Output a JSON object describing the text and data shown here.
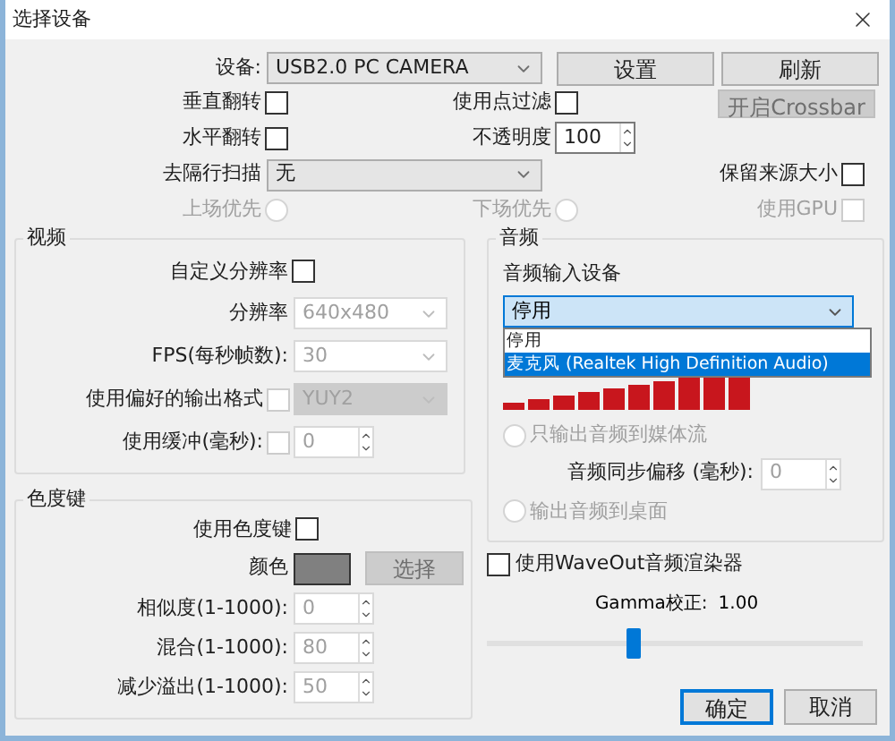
{
  "window": {
    "title": "选择设备"
  },
  "device": {
    "label": "设备:",
    "value": "USB2.0 PC CAMERA"
  },
  "buttons": [
    {
      "label": "设置",
      "disabled": false
    },
    {
      "label": "刷新",
      "disabled": false
    },
    {
      "label": "开启Crossbar",
      "disabled": true
    }
  ],
  "flip_vertical": {
    "label": "垂直翻转",
    "checked": false
  },
  "point_filter": {
    "label": "使用点过滤",
    "checked": false
  },
  "flip_horizontal": {
    "label": "水平翻转",
    "checked": false
  },
  "opacity": {
    "label": "不透明度",
    "value": "100"
  },
  "deinterlace": {
    "label": "去隔行扫描",
    "value": "无"
  },
  "keep_source_size": {
    "label": "保留来源大小",
    "checked": false
  },
  "field_top": {
    "label": "上场优先",
    "selected": false,
    "disabled": true
  },
  "field_bottom": {
    "label": "下场优先",
    "selected": false,
    "disabled": true
  },
  "use_gpu": {
    "label": "使用GPU",
    "checked": false,
    "disabled": true
  },
  "video": {
    "title": "视频",
    "custom_resolution": {
      "label": "自定义分辨率",
      "checked": false
    },
    "resolution": {
      "label": "分辨率",
      "value": "640x480",
      "disabled": true
    },
    "fps": {
      "label": "FPS(每秒帧数):",
      "value": "30",
      "disabled": true
    },
    "preferred_format": {
      "label": "使用偏好的输出格式",
      "checked": false,
      "value": "YUY2",
      "disabled": true
    },
    "buffering": {
      "label": "使用缓冲(毫秒):",
      "checked": false,
      "value": "0",
      "disabled": true
    }
  },
  "audio": {
    "title": "音频",
    "input_label": "音频输入设备",
    "input_value": "停用",
    "options": [
      {
        "label": "停用",
        "selected": false
      },
      {
        "label": "麦克风 (Realtek High Definition Audio)",
        "selected": true
      }
    ],
    "output_stream": {
      "label": "只输出音频到媒体流",
      "selected": false,
      "disabled": true
    },
    "sync_offset": {
      "label": "音频同步偏移 (毫秒):",
      "value": "0",
      "disabled": true
    },
    "output_desktop": {
      "label": "输出音频到桌面",
      "selected": false,
      "disabled": true
    }
  },
  "chroma": {
    "title": "色度键",
    "use": {
      "label": "使用色度键",
      "checked": false
    },
    "color": {
      "label": "颜色",
      "color": "#808080"
    },
    "select_button": {
      "label": "选择",
      "disabled": true
    },
    "fields": [
      {
        "label": "相似度(1-1000):",
        "value": "0",
        "disabled": true
      },
      {
        "label": "混合(1-1000):",
        "value": "80",
        "disabled": true
      },
      {
        "label": "减少溢出(1-1000):",
        "value": "50",
        "disabled": true
      }
    ]
  },
  "waveout": {
    "label": "使用WaveOut音频渲染器",
    "checked": false
  },
  "gamma": {
    "label": "Gamma校正:",
    "reading": "1.00",
    "level": 0.39
  },
  "dialog_buttons": [
    {
      "label": "确定",
      "default": true
    },
    {
      "label": "取消",
      "default": false
    }
  ]
}
